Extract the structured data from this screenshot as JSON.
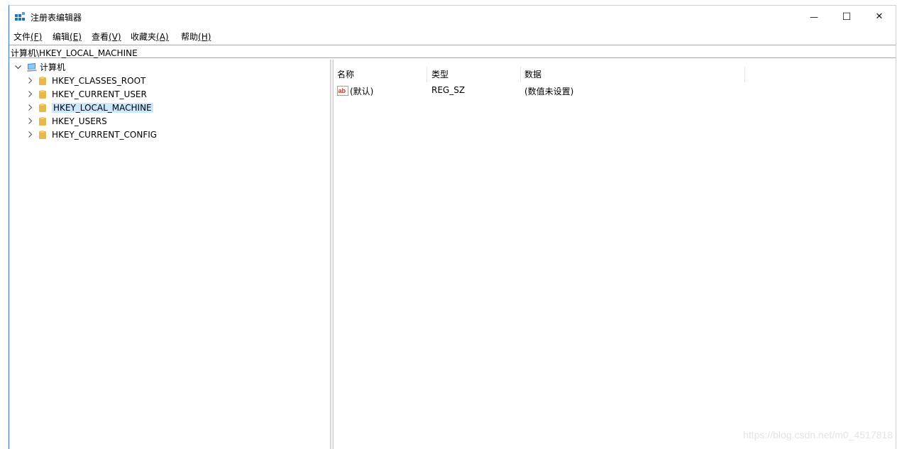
{
  "window": {
    "title": "注册表编辑器",
    "minimize_glyph": "—",
    "maximize_glyph": "☐",
    "close_glyph": "✕"
  },
  "menu": [
    {
      "label": "文件",
      "hotkey": "(F)"
    },
    {
      "label": "编辑",
      "hotkey": "(E)"
    },
    {
      "label": "查看",
      "hotkey": "(V)"
    },
    {
      "label": "收藏夹",
      "hotkey": "(A)"
    },
    {
      "label": "帮助",
      "hotkey": "(H)"
    }
  ],
  "address": "计算机\\HKEY_LOCAL_MACHINE",
  "tree": {
    "root": {
      "label": "计算机",
      "expanded": true,
      "icon": "computer-icon"
    },
    "items": [
      {
        "label": "HKEY_CLASSES_ROOT",
        "selected": false
      },
      {
        "label": "HKEY_CURRENT_USER",
        "selected": false
      },
      {
        "label": "HKEY_LOCAL_MACHINE",
        "selected": true
      },
      {
        "label": "HKEY_USERS",
        "selected": false
      },
      {
        "label": "HKEY_CURRENT_CONFIG",
        "selected": false
      }
    ]
  },
  "list": {
    "columns": [
      "名称",
      "类型",
      "数据"
    ],
    "rows": [
      {
        "name": "(默认)",
        "type": "REG_SZ",
        "data": "(数值未设置)",
        "icon": "string-value-icon"
      }
    ]
  },
  "watermark": "https://blog.csdn.net/m0_4517818",
  "colors": {
    "selection": "#cce8ff",
    "folder": "#e8b94a",
    "accent_border": "#2b79d8"
  }
}
